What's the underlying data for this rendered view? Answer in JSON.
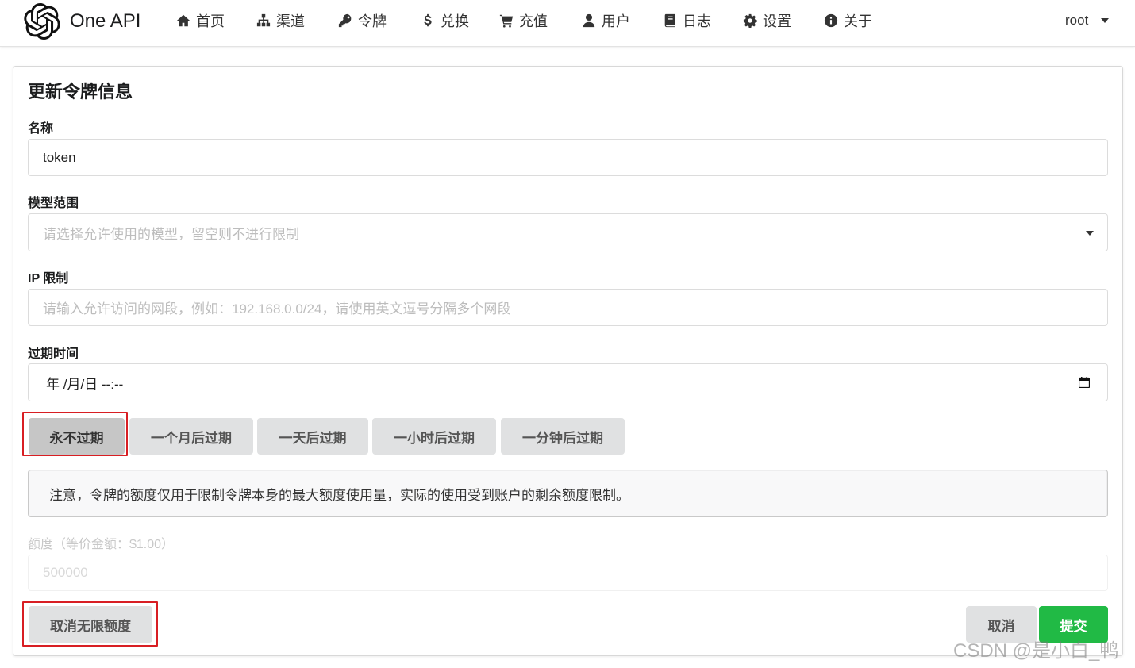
{
  "brand": {
    "name": "One API"
  },
  "nav": [
    {
      "label": "首页",
      "icon": "home-icon"
    },
    {
      "label": "渠道",
      "icon": "sitemap-icon"
    },
    {
      "label": "令牌",
      "icon": "key-icon"
    },
    {
      "label": "兑换",
      "icon": "dollar-icon"
    },
    {
      "label": "充值",
      "icon": "cart-icon"
    },
    {
      "label": "用户",
      "icon": "user-icon"
    },
    {
      "label": "日志",
      "icon": "book-icon"
    },
    {
      "label": "设置",
      "icon": "gear-icon"
    },
    {
      "label": "关于",
      "icon": "info-icon"
    }
  ],
  "user": {
    "name": "root"
  },
  "form": {
    "title": "更新令牌信息",
    "name_label": "名称",
    "name_value": "token",
    "models_label": "模型范围",
    "models_placeholder": "请选择允许使用的模型，留空则不进行限制",
    "ip_label": "IP 限制",
    "ip_placeholder": "请输入允许访问的网段，例如：192.168.0.0/24，请使用英文逗号分隔多个网段",
    "expire_label": "过期时间",
    "expire_value": "年 /月/日 --:--",
    "expire_buttons": [
      "永不过期",
      "一个月后过期",
      "一天后过期",
      "一小时后过期",
      "一分钟后过期"
    ],
    "notice": "注意，令牌的额度仅用于限制令牌本身的最大额度使用量，实际的使用受到账户的剩余额度限制。",
    "quota_label": "额度（等价金额：$1.00）",
    "quota_value": "500000",
    "unlimited_button": "取消无限额度",
    "cancel_button": "取消",
    "submit_button": "提交"
  },
  "watermark": "CSDN @是小白_鸭",
  "colors": {
    "primary_green": "#21ba45",
    "highlight_red": "#d81e23",
    "button_grey": "#e0e1e2"
  }
}
